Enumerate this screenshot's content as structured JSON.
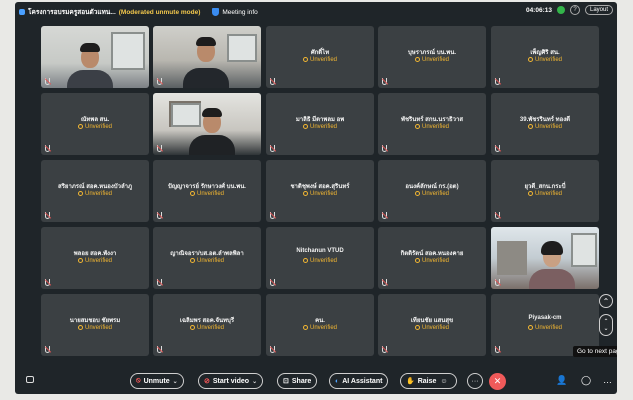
{
  "topbar": {
    "meeting_title": "โครงการอบรมครูสอนตัวแทน...",
    "meeting_mode": "(Moderated unmute mode)",
    "meeting_info_label": "Meeting info",
    "timer": "04:06:13",
    "layout_label": "Layout"
  },
  "tiles": [
    {
      "type": "video",
      "label": "participant-video-1"
    },
    {
      "type": "video",
      "label": "participant-video-2"
    },
    {
      "type": "name",
      "name": "ศักดิ์ไท",
      "status": "Unverified"
    },
    {
      "type": "name",
      "name": "บุษราภรณ์ บน.พน.",
      "status": "Unverified"
    },
    {
      "type": "name",
      "name": "เพ็ญศิริ สน.",
      "status": "Unverified"
    },
    {
      "type": "name",
      "name": "ณัทพล สน.",
      "status": "Unverified"
    },
    {
      "type": "video",
      "label": "participant-video-3"
    },
    {
      "type": "name",
      "name": "มาลิธิ มีดาพลม อพ",
      "status": "Unverified"
    },
    {
      "type": "name",
      "name": "พัชรินทร์ สกน.นราธิวาส",
      "status": "Unverified"
    },
    {
      "type": "name",
      "name": "39.พัชรรินทร์ ทองดี",
      "status": "Unverified"
    },
    {
      "type": "name",
      "name": "สริยาภรณ์ สอค.หนองบัวลำภู",
      "status": "Unverified"
    },
    {
      "type": "name",
      "name": "ปัญญาจารย์ รักษาวงศ์ บน.พน.",
      "status": "Unverified"
    },
    {
      "type": "name",
      "name": "ชาติชุพงษ์ สอค.สุรินทร์",
      "status": "Unverified"
    },
    {
      "type": "name",
      "name": "อนงค์ลักษณ์ กร.(อต)",
      "status": "Unverified"
    },
    {
      "type": "name",
      "name": "ยุวดี_สกน.กระบี่",
      "status": "Unverified"
    },
    {
      "type": "name",
      "name": "พลอย สอค.พังงา",
      "status": "Unverified"
    },
    {
      "type": "name",
      "name": "ญาณิจอรา/บส.อต.ลำพลพิลา",
      "status": "Unverified"
    },
    {
      "type": "name",
      "name": "Nitchanun VTUD",
      "status": "Unverified"
    },
    {
      "type": "name",
      "name": "กิตติรัตน์ สอค.หนองคาย",
      "status": "Unverified"
    },
    {
      "type": "video",
      "label": "participant-video-4"
    },
    {
      "type": "name",
      "name": "นายสมชอบ ชัยพรม",
      "status": "Unverified"
    },
    {
      "type": "name",
      "name": "เฉลิมพร สอค.จันทบุรี",
      "status": "Unverified"
    },
    {
      "type": "name",
      "name": "คน.",
      "status": "Unverified"
    },
    {
      "type": "name",
      "name": "เทียนชัย แสนสุข",
      "status": "Unverified"
    },
    {
      "type": "name",
      "name": "Piyasak-cm",
      "status": "Unverified"
    }
  ],
  "nav": {
    "tooltip": "Go to next page"
  },
  "controls": {
    "unmute": "Unmute",
    "start_video": "Start video",
    "share": "Share",
    "ai_assistant": "AI Assistant",
    "raise": "Raise",
    "more": "···",
    "leave": "✕"
  },
  "colors": {
    "unverified": "#f2b632",
    "leave": "#f05a5a",
    "tile_bg": "#3b4043"
  }
}
